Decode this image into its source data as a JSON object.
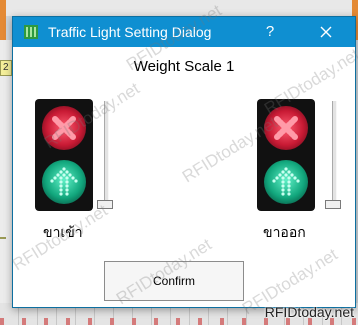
{
  "dialog": {
    "title": "Traffic Light Setting Dialog",
    "help_label": "?",
    "heading": "Weight Scale 1",
    "confirm_label": "Confirm"
  },
  "lanes": [
    {
      "label": "ขาเข้า",
      "red_signal": "stop-cross",
      "green_signal": "go-arrow-up",
      "slider_level": 0.0
    },
    {
      "label": "ขาออก",
      "red_signal": "stop-cross",
      "green_signal": "go-arrow-up",
      "slider_level": 0.0
    }
  ],
  "background": {
    "tag_labels": [
      "2",
      ""
    ]
  },
  "watermark": {
    "text": "RFIDtoday.net",
    "corner_text": "RFIDtoday.net"
  },
  "colors": {
    "titlebar": "#0f8fd1",
    "red_lamp": "#e0223e",
    "green_lamp": "#21c498",
    "lamp_housing": "#111111"
  },
  "icons": {
    "app": "traffic-light-icon",
    "close": "close-icon",
    "help": "help-icon"
  }
}
